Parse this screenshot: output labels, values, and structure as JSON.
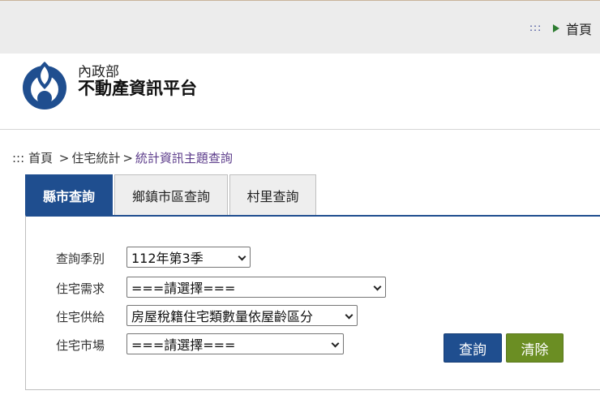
{
  "topbar": {
    "dots": ":::",
    "home_label": "首頁"
  },
  "header": {
    "org": "內政部",
    "site_title": "不動產資訊平台"
  },
  "breadcrumb": {
    "prefix": ":::",
    "home": "首頁",
    "sep": ">",
    "section": "住宅統計",
    "current": "統計資訊主題查詢"
  },
  "tabs": [
    {
      "label": "縣市查詢",
      "active": true
    },
    {
      "label": "鄉鎮市區查詢",
      "active": false
    },
    {
      "label": "村里查詢",
      "active": false
    }
  ],
  "form": {
    "season_label": "查詢季別",
    "season_value": "112年第3季",
    "demand_label": "住宅需求",
    "demand_value": "===請選擇===",
    "supply_label": "住宅供給",
    "supply_value": "房屋稅籍住宅類數量依屋齡區分",
    "market_label": "住宅市場",
    "market_value": "===請選擇==="
  },
  "buttons": {
    "query": "查詢",
    "clear": "清除"
  },
  "colors": {
    "primary": "#1f4e8f",
    "clear": "#6b8e23",
    "current_crumb": "#5b3b8a"
  }
}
